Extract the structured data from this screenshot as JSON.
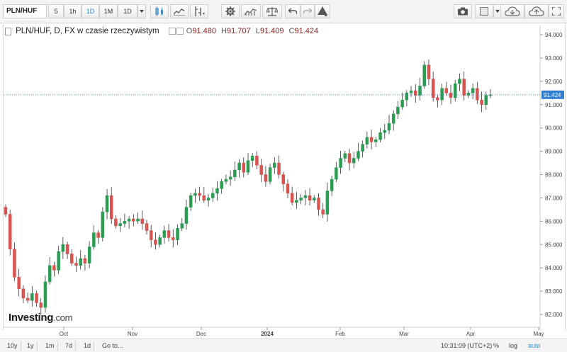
{
  "toolbar": {
    "symbol": "PLN/HUF",
    "intervals": [
      "5",
      "1h",
      "1D",
      "1M",
      "1D"
    ],
    "active_interval": "1D",
    "icons": [
      "candle-style-icon",
      "indicator-icon",
      "compare-icon",
      "settings-icon",
      "studies-icon",
      "scale-icon",
      "undo-icon",
      "redo-icon",
      "drawing-icon",
      "camera-icon",
      "color-box-icon",
      "cloud-load-icon",
      "cloud-save-icon",
      "fullscreen-icon"
    ]
  },
  "legend": {
    "title": "PLN/HUF, D, FX w czasie rzeczywistym",
    "open_label": "O",
    "open": "91.480",
    "high_label": "H",
    "high": "91.707",
    "low_label": "L",
    "low": "91.409",
    "close_label": "C",
    "close": "91.424"
  },
  "logo": {
    "brand": "Investing",
    "domain": ".com"
  },
  "bottom_bar": {
    "ranges": [
      "10y",
      "1y",
      "1m",
      "7d",
      "1d",
      "Go to..."
    ],
    "time": "10:31:09 (UTC+2)",
    "pct": "%",
    "log": "log",
    "auto": "auto"
  },
  "colors": {
    "up": "#2a9d52",
    "down": "#d9534f",
    "last_price_bg": "#2f7fd3",
    "accent": "#2f8fd8"
  },
  "chart_data": {
    "type": "candlestick",
    "title": "PLN/HUF, D, FX w czasie rzeczywistym",
    "xlabel": "",
    "ylabel": "",
    "ylim": [
      81.5,
      94.2
    ],
    "y_ticks": [
      "82.000",
      "83.000",
      "84.000",
      "85.000",
      "86.000",
      "87.000",
      "88.000",
      "89.000",
      "90.000",
      "91.000",
      "92.000",
      "93.000",
      "94.000"
    ],
    "x_ticks": [
      "Oct",
      "Nov",
      "Dec",
      "2024",
      "Feb",
      "Mar",
      "Apr",
      "May"
    ],
    "last_price": "91.424",
    "closes": [
      86.3,
      84.8,
      83.6,
      83.1,
      82.7,
      82.6,
      82.9,
      82.5,
      82.3,
      83.4,
      84.1,
      83.9,
      84.7,
      85.0,
      84.6,
      84.2,
      84.1,
      84.4,
      84.2,
      84.9,
      85.5,
      85.3,
      86.4,
      87.1,
      86.1,
      85.8,
      85.9,
      86.0,
      86.1,
      86.0,
      86.1,
      85.9,
      85.6,
      85.2,
      85.0,
      85.3,
      85.6,
      85.3,
      85.2,
      85.7,
      85.9,
      86.6,
      87.1,
      87.2,
      87.1,
      86.9,
      87.0,
      87.2,
      87.4,
      87.7,
      87.8,
      87.9,
      88.2,
      88.5,
      88.1,
      88.6,
      88.8,
      88.4,
      88.0,
      87.7,
      88.3,
      88.5,
      88.0,
      87.6,
      87.2,
      86.8,
      86.9,
      87.0,
      87.1,
      86.9,
      87.0,
      86.5,
      86.3,
      87.3,
      87.8,
      88.3,
      88.7,
      88.9,
      88.5,
      88.7,
      89.0,
      89.3,
      89.6,
      89.4,
      89.5,
      89.8,
      89.9,
      90.2,
      90.6,
      90.9,
      91.2,
      91.5,
      91.6,
      91.4,
      91.8,
      92.7,
      92.1,
      91.3,
      91.2,
      91.7,
      91.5,
      91.3,
      91.9,
      92.1,
      91.4,
      91.5,
      91.7,
      91.2,
      91.0,
      91.4,
      91.424
    ]
  }
}
